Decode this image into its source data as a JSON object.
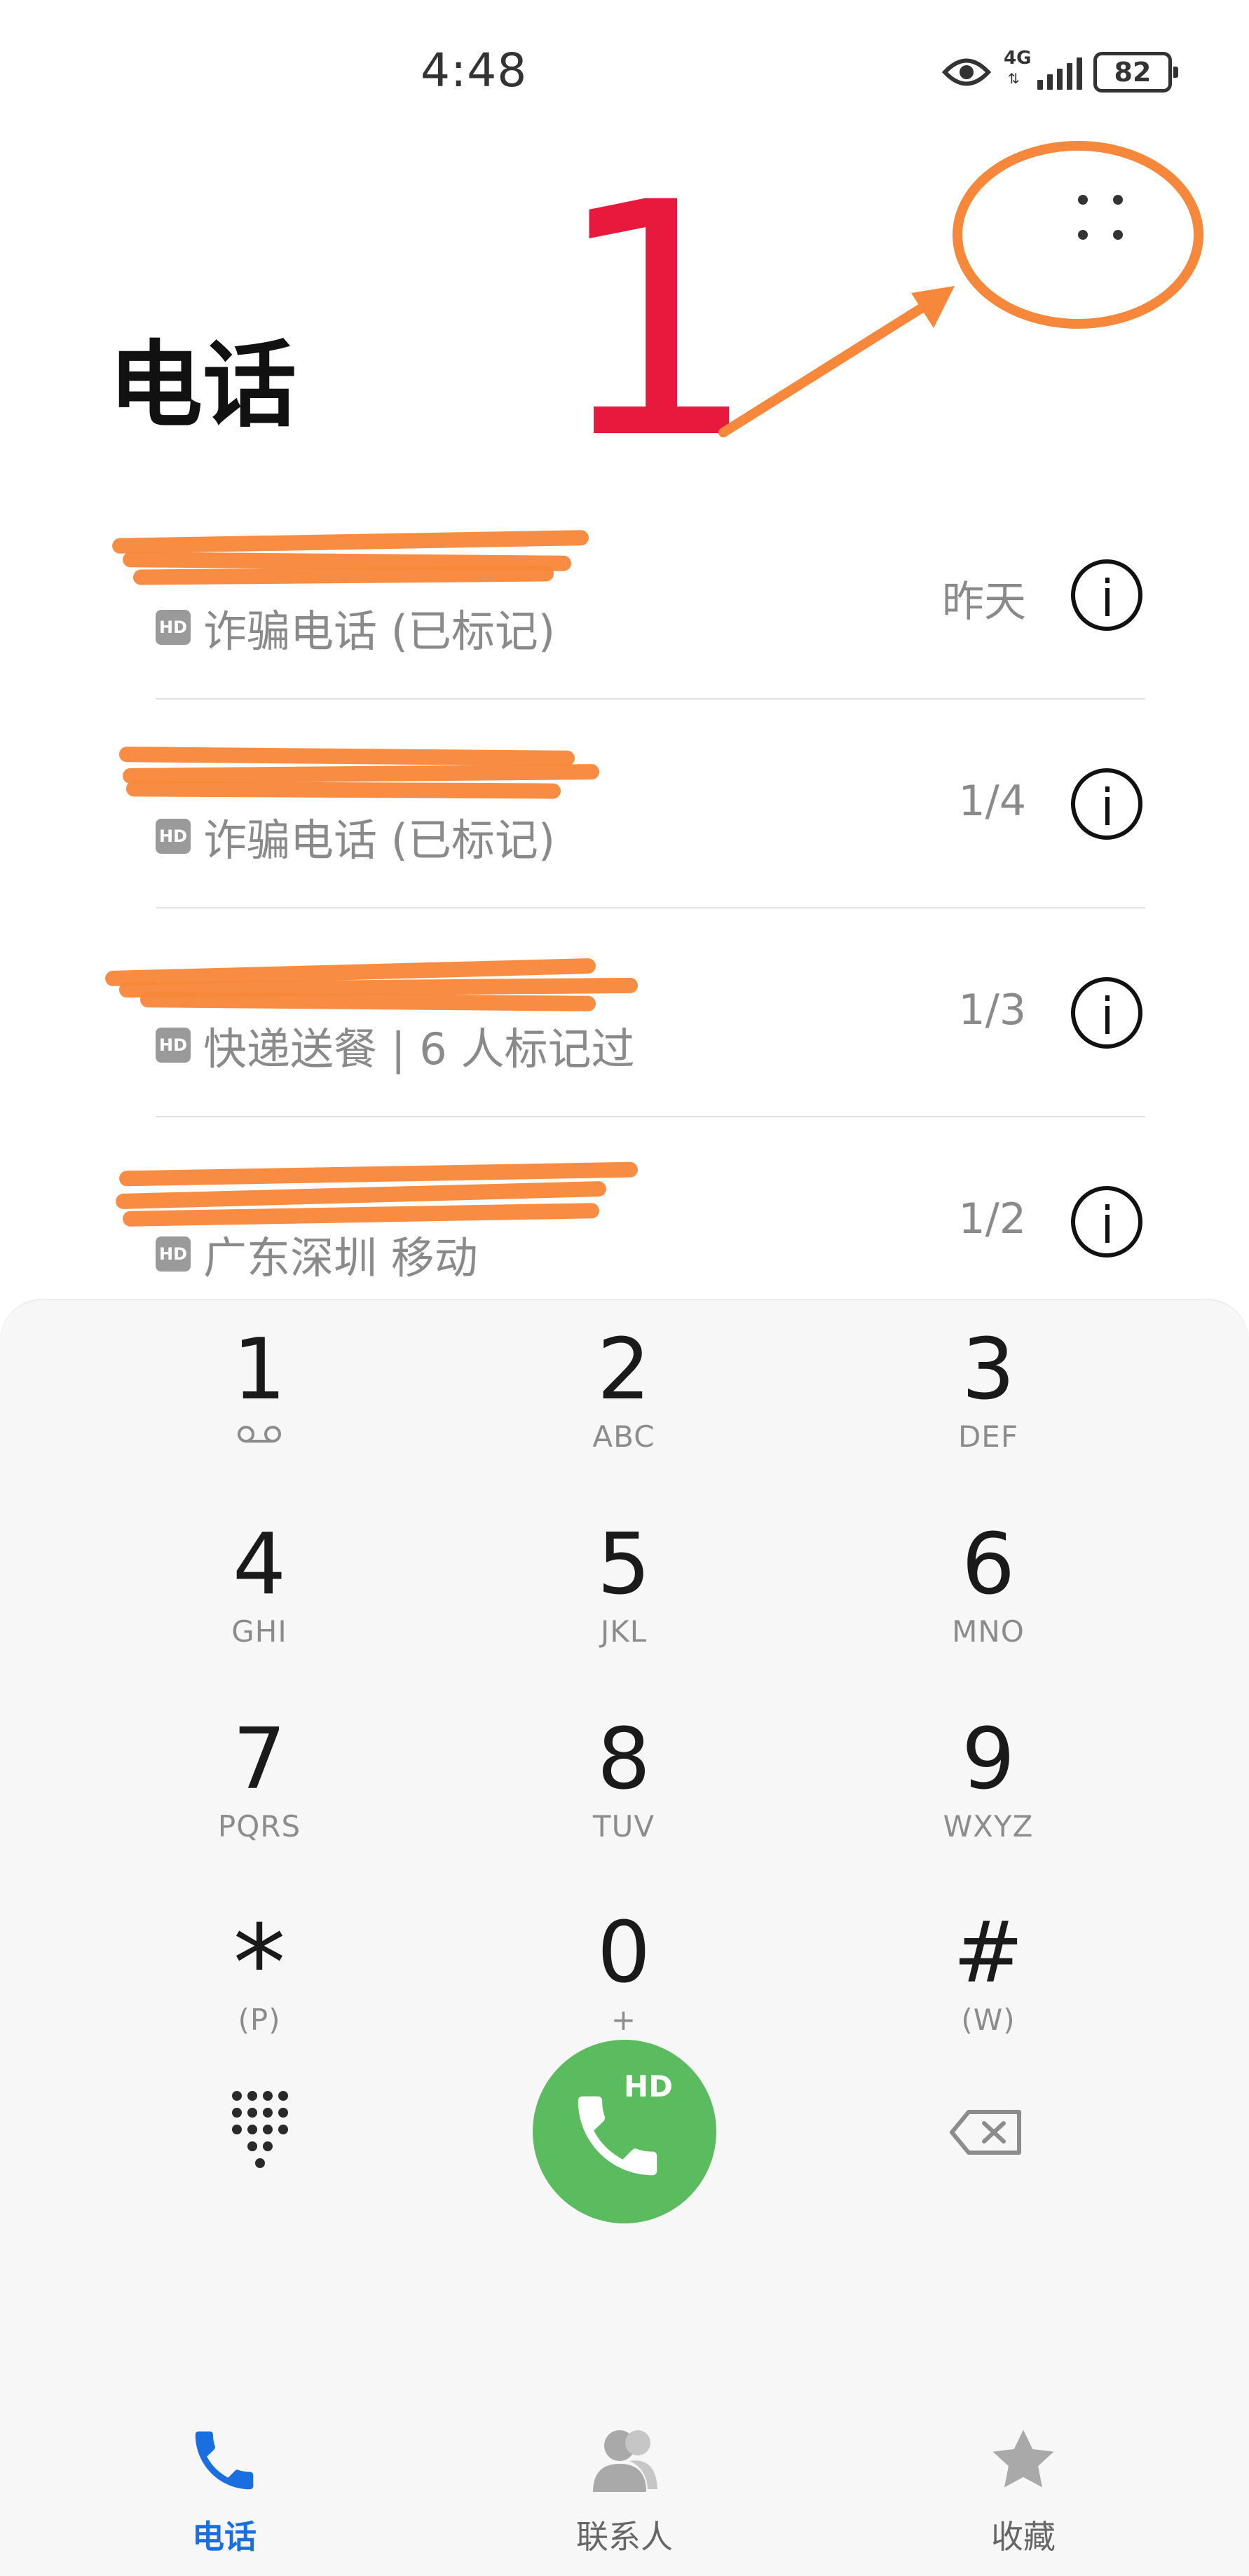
{
  "status_bar": {
    "time": "4:48",
    "network": "4G",
    "battery": "82",
    "icons": [
      "eye-icon",
      "signal-icon",
      "battery-icon"
    ]
  },
  "header": {
    "title": "电话",
    "annotation_number": "1",
    "more_icon": "more-dots-icon"
  },
  "call_log": [
    {
      "number": "",
      "label": "诈骗电话 (已标记)",
      "date": "昨天",
      "hd": "HD"
    },
    {
      "number": "",
      "label": "诈骗电话 (已标记)",
      "date": "1/4",
      "hd": "HD"
    },
    {
      "number": "",
      "label": "快递送餐 | 6 人标记过",
      "date": "1/3",
      "hd": "HD"
    },
    {
      "number": "",
      "label": "广东深圳 移动",
      "date": "1/2",
      "hd": "HD"
    }
  ],
  "dialpad": {
    "keys": [
      {
        "digit": "1",
        "letters": ""
      },
      {
        "digit": "2",
        "letters": "ABC"
      },
      {
        "digit": "3",
        "letters": "DEF"
      },
      {
        "digit": "4",
        "letters": "GHI"
      },
      {
        "digit": "5",
        "letters": "JKL"
      },
      {
        "digit": "6",
        "letters": "MNO"
      },
      {
        "digit": "7",
        "letters": "PQRS"
      },
      {
        "digit": "8",
        "letters": "TUV"
      },
      {
        "digit": "9",
        "letters": "WXYZ"
      },
      {
        "digit": "*",
        "letters": "(P)"
      },
      {
        "digit": "0",
        "letters": "+"
      },
      {
        "digit": "#",
        "letters": "(W)"
      }
    ],
    "call_button_badge": "HD"
  },
  "bottom_nav": [
    {
      "label": "电话",
      "icon": "phone-icon",
      "active": true
    },
    {
      "label": "联系人",
      "icon": "contacts-icon",
      "active": false
    },
    {
      "label": "收藏",
      "icon": "star-icon",
      "active": false
    }
  ],
  "colors": {
    "accent": "#1a6fe0",
    "call_green": "#5bbb5f",
    "annotation_orange": "#f7873a",
    "annotation_red": "#e8193c"
  }
}
